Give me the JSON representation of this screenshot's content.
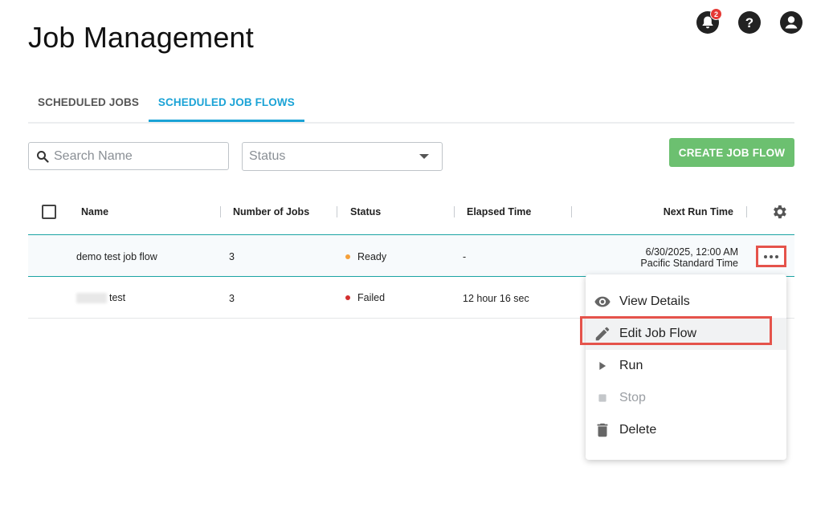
{
  "header": {
    "title": "Job Management",
    "notification_count": "2"
  },
  "tabs": [
    {
      "label": "SCHEDULED JOBS",
      "active": false
    },
    {
      "label": "SCHEDULED JOB FLOWS",
      "active": true
    }
  ],
  "filters": {
    "search_placeholder": "Search Name",
    "status_placeholder": "Status"
  },
  "actions": {
    "create_label": "CREATE JOB FLOW"
  },
  "table": {
    "columns": [
      "Name",
      "Number of Jobs",
      "Status",
      "Elapsed Time",
      "Next Run Time"
    ],
    "rows": [
      {
        "name": "demo test job flow",
        "jobs": "3",
        "status": "Ready",
        "status_color": "#f5a03a",
        "elapsed": "-",
        "next_run_line1": "6/30/2025, 12:00 AM",
        "next_run_line2": "Pacific Standard Time"
      },
      {
        "name": "test",
        "jobs": "3",
        "status": "Failed",
        "status_color": "#d32f2f",
        "elapsed": "12 hour 16 sec",
        "next_run_line1": "",
        "next_run_line2": ""
      }
    ]
  },
  "context_menu": {
    "items": [
      {
        "label": "View Details",
        "icon": "eye-icon"
      },
      {
        "label": "Edit Job Flow",
        "icon": "pencil-icon"
      },
      {
        "label": "Run",
        "icon": "play-icon"
      },
      {
        "label": "Stop",
        "icon": "stop-icon"
      },
      {
        "label": "Delete",
        "icon": "trash-icon"
      }
    ]
  },
  "colors": {
    "accent": "#1ba3d6",
    "create_button": "#6cc070",
    "highlight": "#e5534b"
  }
}
